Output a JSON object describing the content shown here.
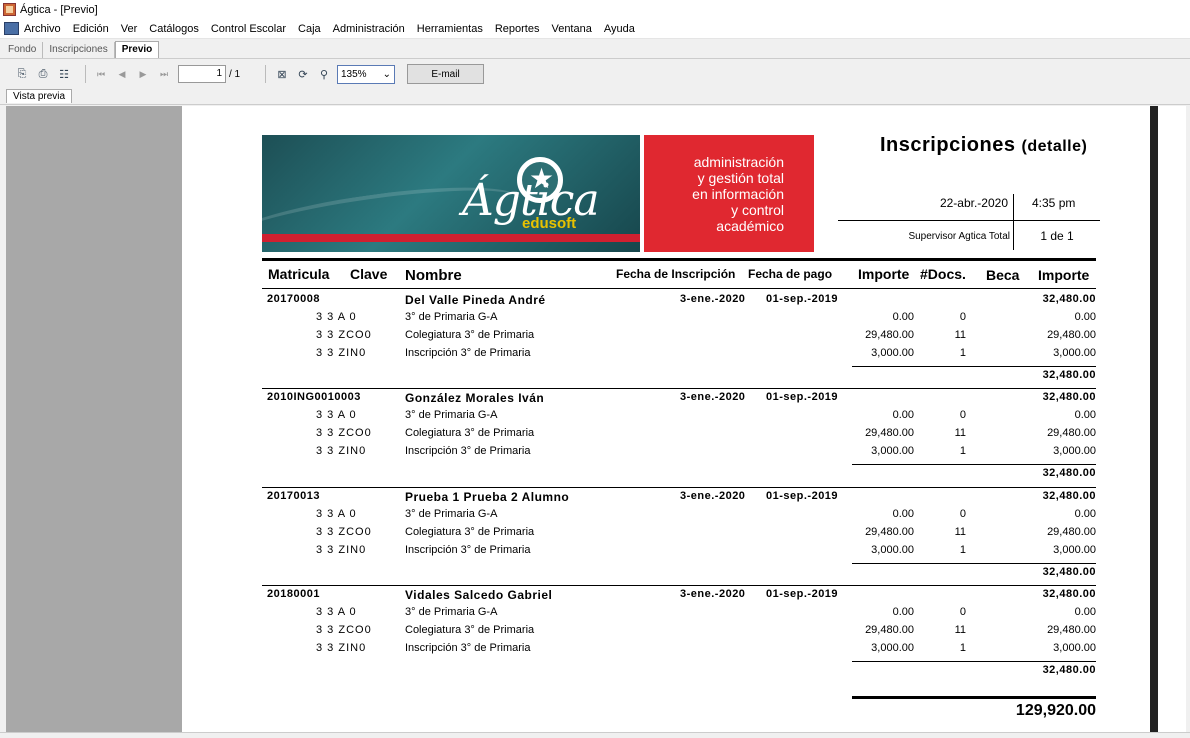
{
  "window": {
    "title": "Ágtica - [Previo]"
  },
  "menu": [
    "Archivo",
    "Edición",
    "Ver",
    "Catálogos",
    "Control Escolar",
    "Caja",
    "Administración",
    "Herramientas",
    "Reportes",
    "Ventana",
    "Ayuda"
  ],
  "tabs": [
    {
      "label": "Fondo",
      "active": false
    },
    {
      "label": "Inscripciones",
      "active": false
    },
    {
      "label": "Previo",
      "active": true
    }
  ],
  "toolbar": {
    "page_current": "1",
    "page_total": "/ 1",
    "zoom": "135%",
    "email_label": "E-mail"
  },
  "subtab": {
    "label": "Vista previa"
  },
  "report": {
    "logo_brand": "Ágtica",
    "logo_sub": "edusoft",
    "logo_tagline": [
      "administración",
      "y gestión total",
      "en información",
      "y control",
      "académico"
    ],
    "title": "Inscripciones",
    "title_suffix": "(detalle)",
    "date": "22-abr.-2020",
    "time": "4:35 pm",
    "user": "Supervisor Agtica Total",
    "page": "1 de 1",
    "columns": [
      "Matricula",
      "Clave",
      "Nombre",
      "Fecha de Inscripción",
      "Fecha de pago",
      "Importe",
      "#Docs.",
      "Beca",
      "Importe"
    ],
    "groups": [
      {
        "matricula": "20170008",
        "nombre": "Del Valle Pineda André",
        "fecha_insc": "3-ene.-2020",
        "fecha_pago": "01-sep.-2019",
        "total": "32,480.00",
        "items": [
          {
            "clave": "3 3 A 0",
            "nombre": "3° de Primaria G-A",
            "importe": "0.00",
            "docs": "0",
            "importe2": "0.00"
          },
          {
            "clave": "3 3 ZCO0",
            "nombre": "Colegiatura 3° de Primaria",
            "importe": "29,480.00",
            "docs": "11",
            "importe2": "29,480.00"
          },
          {
            "clave": "3 3 ZIN0",
            "nombre": "Inscripción 3° de Primaria",
            "importe": "3,000.00",
            "docs": "1",
            "importe2": "3,000.00"
          }
        ],
        "subtotal": "32,480.00"
      },
      {
        "matricula": "2010ING0010003",
        "nombre": "González Morales Iván",
        "fecha_insc": "3-ene.-2020",
        "fecha_pago": "01-sep.-2019",
        "total": "32,480.00",
        "items": [
          {
            "clave": "3 3 A 0",
            "nombre": "3° de Primaria G-A",
            "importe": "0.00",
            "docs": "0",
            "importe2": "0.00"
          },
          {
            "clave": "3 3 ZCO0",
            "nombre": "Colegiatura 3° de Primaria",
            "importe": "29,480.00",
            "docs": "11",
            "importe2": "29,480.00"
          },
          {
            "clave": "3 3 ZIN0",
            "nombre": "Inscripción 3° de Primaria",
            "importe": "3,000.00",
            "docs": "1",
            "importe2": "3,000.00"
          }
        ],
        "subtotal": "32,480.00"
      },
      {
        "matricula": "20170013",
        "nombre": "Prueba 1 Prueba 2 Alumno",
        "fecha_insc": "3-ene.-2020",
        "fecha_pago": "01-sep.-2019",
        "total": "32,480.00",
        "items": [
          {
            "clave": "3 3 A 0",
            "nombre": "3° de Primaria G-A",
            "importe": "0.00",
            "docs": "0",
            "importe2": "0.00"
          },
          {
            "clave": "3 3 ZCO0",
            "nombre": "Colegiatura 3° de Primaria",
            "importe": "29,480.00",
            "docs": "11",
            "importe2": "29,480.00"
          },
          {
            "clave": "3 3 ZIN0",
            "nombre": "Inscripción 3° de Primaria",
            "importe": "3,000.00",
            "docs": "1",
            "importe2": "3,000.00"
          }
        ],
        "subtotal": "32,480.00"
      },
      {
        "matricula": "20180001",
        "nombre": "Vidales Salcedo Gabriel",
        "fecha_insc": "3-ene.-2020",
        "fecha_pago": "01-sep.-2019",
        "total": "32,480.00",
        "items": [
          {
            "clave": "3 3 A 0",
            "nombre": "3° de Primaria G-A",
            "importe": "0.00",
            "docs": "0",
            "importe2": "0.00"
          },
          {
            "clave": "3 3 ZCO0",
            "nombre": "Colegiatura 3° de Primaria",
            "importe": "29,480.00",
            "docs": "11",
            "importe2": "29,480.00"
          },
          {
            "clave": "3 3 ZIN0",
            "nombre": "Inscripción 3° de Primaria",
            "importe": "3,000.00",
            "docs": "1",
            "importe2": "3,000.00"
          }
        ],
        "subtotal": "32,480.00"
      }
    ],
    "grand_total": "129,920.00"
  }
}
